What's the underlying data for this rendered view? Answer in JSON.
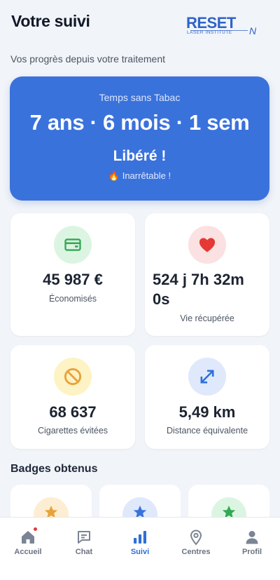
{
  "header": {
    "title": "Votre suivi",
    "logo": {
      "main": "RESET",
      "sub": "LASER INSTITUTE",
      "mark": "N"
    }
  },
  "subtitle": "Vos progrès depuis votre traitement",
  "hero": {
    "label": "Temps sans Tabac",
    "time": "7 ans · 6 mois · 1 sem",
    "status": "Libéré !",
    "motivation": "🔥 Inarrêtable !"
  },
  "stats": [
    {
      "value": "45 987 €",
      "label": "Économisés",
      "icon": "wallet-icon",
      "icon_bg": "#dcf5e3",
      "icon_color": "#34a853"
    },
    {
      "value": "524 j 7h 32m 0s",
      "label": "Vie récupérée",
      "icon": "heart-icon",
      "icon_bg": "#fbe1e1",
      "icon_color": "#e53935"
    },
    {
      "value": "68 637",
      "label": "Cigarettes évitées",
      "icon": "no-smoking-icon",
      "icon_bg": "#fdf3c4",
      "icon_color": "#e9a23b"
    },
    {
      "value": "5,49 km",
      "label": "Distance équivalente",
      "icon": "expand-arrows-icon",
      "icon_bg": "#dfe9fb",
      "icon_color": "#2f6fd8"
    }
  ],
  "badges": {
    "title": "Badges obtenus",
    "items": [
      {
        "icon": "star-icon",
        "bg": "#fdeed3",
        "color": "#e9a23b"
      },
      {
        "icon": "star-icon",
        "bg": "#dfe9fb",
        "color": "#3a72dc"
      },
      {
        "icon": "star-icon",
        "bg": "#dcf5e3",
        "color": "#34a853"
      }
    ]
  },
  "tabbar": {
    "items": [
      {
        "label": "Accueil",
        "icon": "home-icon",
        "badge": true
      },
      {
        "label": "Chat",
        "icon": "chat-icon"
      },
      {
        "label": "Suivi",
        "icon": "bar-chart-icon",
        "active": true
      },
      {
        "label": "Centres",
        "icon": "location-pin-icon"
      },
      {
        "label": "Profil",
        "icon": "user-icon"
      }
    ]
  },
  "colors": {
    "accent": "#3a72dc",
    "background": "#f1f4f9",
    "notification": "#e53935"
  }
}
